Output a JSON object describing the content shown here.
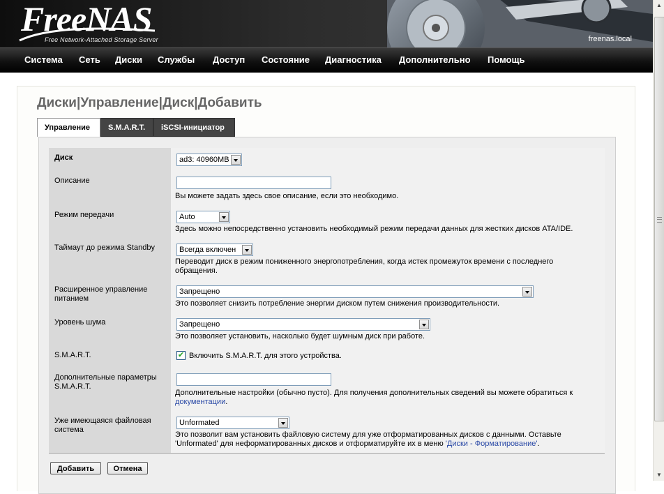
{
  "header": {
    "logo_text": "FreeNAS",
    "logo_subtitle": "Free Network-Attached Storage Server",
    "hostname": "freenas.local"
  },
  "nav": {
    "items": [
      "Система",
      "Сеть",
      "Диски",
      "Службы",
      "Доступ",
      "Состояние",
      "Диагностика",
      "Дополнительно",
      "Помощь"
    ]
  },
  "page": {
    "title_parts": [
      "Диски",
      "Управление",
      "Диск",
      "Добавить"
    ],
    "separator": "|"
  },
  "tabs": [
    {
      "label": "Управление",
      "active": true
    },
    {
      "label": "S.M.A.R.T.",
      "active": false
    },
    {
      "label": "iSCSI-инициатор",
      "active": false
    }
  ],
  "form": {
    "disk": {
      "label": "Диск",
      "value": "ad3: 40960MB"
    },
    "description": {
      "label": "Описание",
      "value": "",
      "hint": "Вы можете задать здесь свое описание, если это необходимо."
    },
    "transfer_mode": {
      "label": "Режим передачи",
      "value": "Auto",
      "hint": "Здесь можно непосредственно установить необходимый режим передачи данных для жестких дисков ATA/IDE."
    },
    "standby": {
      "label": "Таймаут до режима Standby",
      "value": "Всегда включен",
      "hint": "Переводит диск в режим пониженного энергопотребления, когда истек промежуток времени с последнего обращения."
    },
    "apm": {
      "label": "Расширенное управление питанием",
      "value": "Запрещено",
      "hint": "Это позволяет снизить потребление энергии диском путем снижения производительности."
    },
    "noise": {
      "label": "Уровень шума",
      "value": "Запрещено",
      "hint": "Это позволяет установить, насколько будет шумным диск при работе."
    },
    "smart": {
      "label": "S.M.A.R.T.",
      "checked": true,
      "checkbox_label": "Включить S.M.A.R.T. для этого устройства."
    },
    "smart_extra": {
      "label": "Дополнительные параметры S.M.A.R.T.",
      "value": "",
      "hint_before": "Дополнительные настройки (обычно пусто). Для получения дополнительных сведений вы можете обратиться к ",
      "hint_link": "документации",
      "hint_after": "."
    },
    "filesystem": {
      "label": "Уже имеющаяся файловая система",
      "value": "Unformated",
      "hint_before": "Это позволит вам установить файловую систему для уже отформатированных дисков с данными. Оставьте 'Unformated' для неформатированных дисков и отформатируйте их в меню ",
      "hint_link": "'Диски - Форматирование'",
      "hint_after": "."
    }
  },
  "buttons": {
    "add": "Добавить",
    "cancel": "Отмена"
  }
}
